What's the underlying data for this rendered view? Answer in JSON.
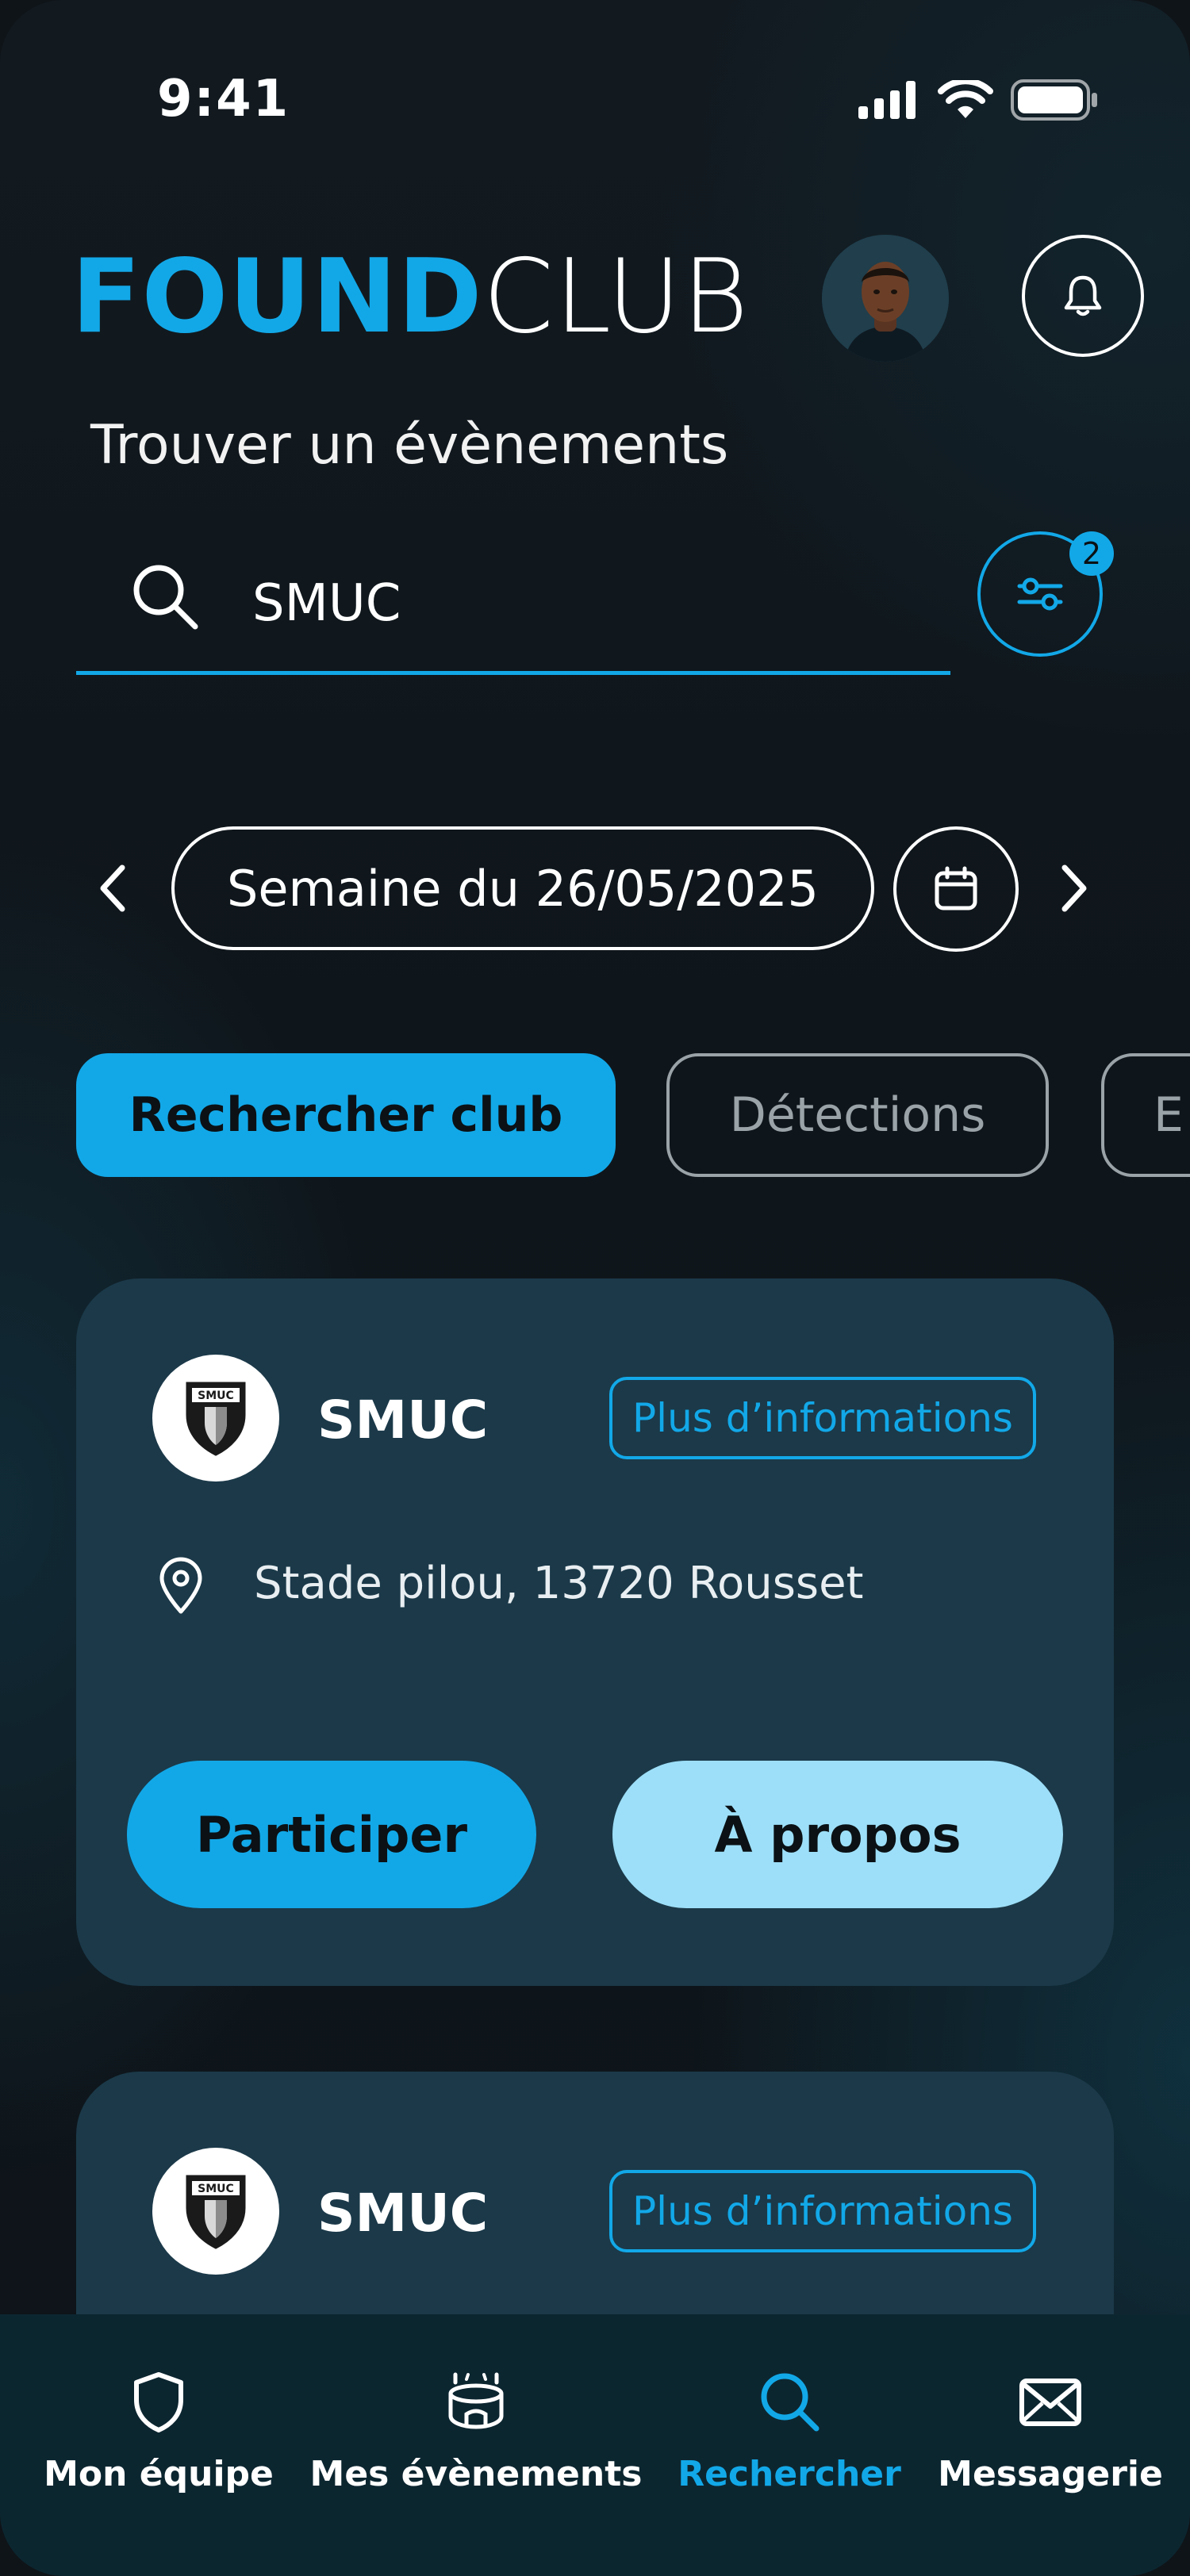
{
  "status_bar": {
    "time": "9:41"
  },
  "header": {
    "logo_found": "FOUND",
    "logo_club": "CLUB",
    "page_title": "Trouver un évènements"
  },
  "search": {
    "value": "SMUC",
    "filter_count": "2"
  },
  "week": {
    "label": "Semaine du 26/05/2025"
  },
  "tabs": [
    {
      "label": "Rechercher club",
      "active": true
    },
    {
      "label": "Détections",
      "active": false
    },
    {
      "label": "E",
      "active": false
    }
  ],
  "cards": [
    {
      "club_name": "SMUC",
      "logo_text": "SMUC",
      "info_label": "Plus d’informations",
      "location": "Stade pilou, 13720 Rousset",
      "participate_label": "Participer",
      "about_label": "À propos"
    },
    {
      "club_name": "SMUC",
      "logo_text": "SMUC",
      "info_label": "Plus d’informations"
    }
  ],
  "bottom_nav": [
    {
      "label": "Mon équipe",
      "icon": "shield-icon",
      "active": false
    },
    {
      "label": "Mes évènements",
      "icon": "stadium-icon",
      "active": false
    },
    {
      "label": "Rechercher",
      "icon": "search-icon",
      "active": true
    },
    {
      "label": "Messagerie",
      "icon": "mail-icon",
      "active": false
    }
  ],
  "colors": {
    "accent": "#12a8e8",
    "card_bg": "#1b3949",
    "about_button": "#9ddff8",
    "nav_bg": "#0c2630"
  }
}
